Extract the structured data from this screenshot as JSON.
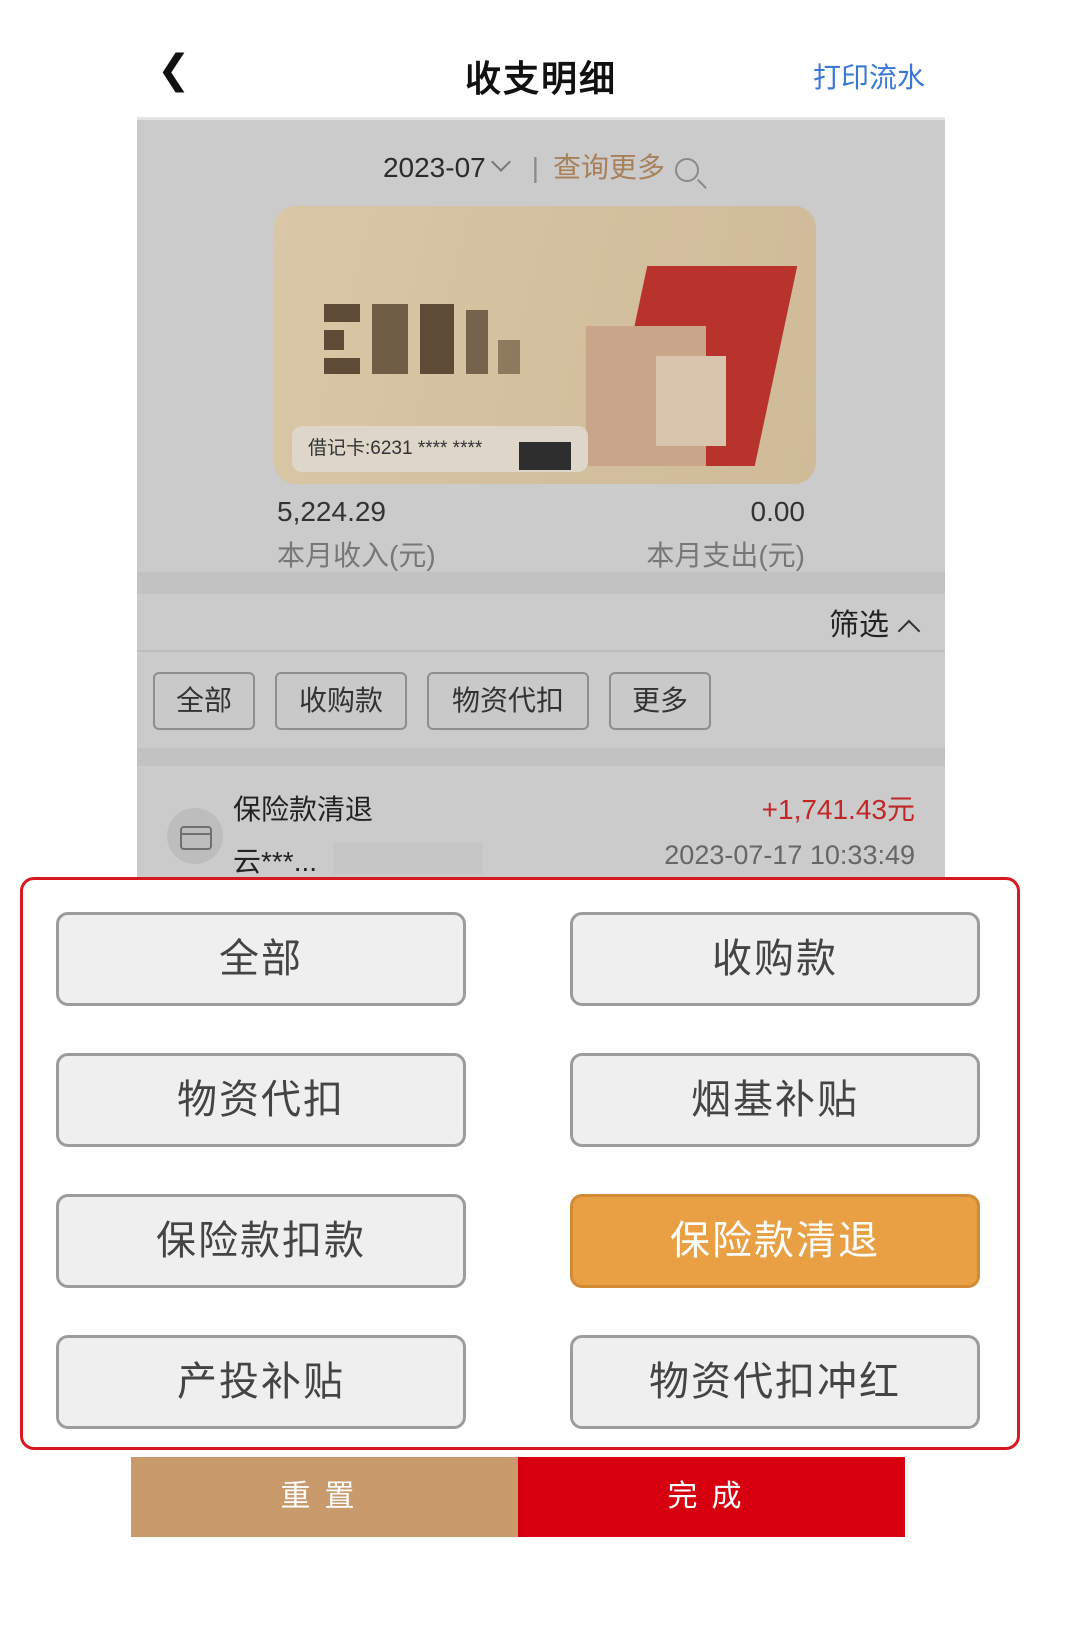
{
  "header": {
    "back_icon": "chevron-left-icon",
    "title": "收支明细",
    "print_label": "打印流水"
  },
  "query": {
    "month": "2023-07",
    "separator": "|",
    "more_label": "查询更多"
  },
  "card": {
    "label": "借记卡:6231 **** ****"
  },
  "summary": {
    "income_value": "5,224.29",
    "income_label": "本月收入(元)",
    "expense_value": "0.00",
    "expense_label": "本月支出(元)"
  },
  "filter": {
    "toggle_label": "筛选",
    "chips": [
      "全部",
      "收购款",
      "物资代扣",
      "更多"
    ]
  },
  "transaction": {
    "title": "保险款清退",
    "amount": "+1,741.43元",
    "counterparty": "云***...",
    "time": "2023-07-17 10:33:49"
  },
  "panel": {
    "options": [
      "全部",
      "收购款",
      "物资代扣",
      "烟基补贴",
      "保险款扣款",
      "保险款清退",
      "产投补贴",
      "物资代扣冲红"
    ],
    "selected": "保险款清退"
  },
  "footer": {
    "reset_label": "重置",
    "done_label": "完成"
  },
  "colors": {
    "accent_blue": "#3b78d6",
    "primary_red": "#d7000f",
    "reset_tan": "#c99b6c",
    "selected_orange": "#e9a045",
    "amount_red": "#c22626"
  }
}
